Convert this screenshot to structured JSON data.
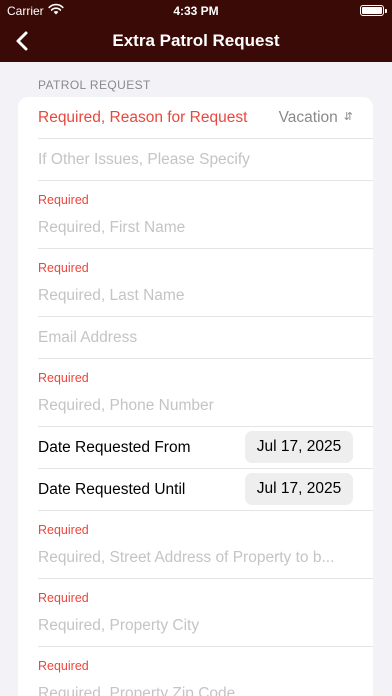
{
  "status_bar": {
    "carrier": "Carrier",
    "time": "4:33 PM"
  },
  "nav": {
    "title": "Extra Patrol Request"
  },
  "section": {
    "header": "PATROL REQUEST"
  },
  "form": {
    "reason": {
      "label": "Required, Reason for Request",
      "value": "Vacation"
    },
    "other_issues": {
      "placeholder": "If Other Issues, Please Specify"
    },
    "first_name": {
      "required": "Required",
      "placeholder": "Required, First Name"
    },
    "last_name": {
      "required": "Required",
      "placeholder": "Required, Last Name"
    },
    "email": {
      "placeholder": "Email Address"
    },
    "phone": {
      "required": "Required",
      "placeholder": "Required, Phone Number"
    },
    "date_from": {
      "label": "Date Requested From",
      "value": "Jul 17, 2025"
    },
    "date_until": {
      "label": "Date Requested Until",
      "value": "Jul 17, 2025"
    },
    "street": {
      "required": "Required",
      "placeholder": "Required, Street Address of Property to b..."
    },
    "city": {
      "required": "Required",
      "placeholder": "Required, Property City"
    },
    "zip": {
      "required": "Required",
      "placeholder": "Required, Property Zip Code"
    }
  }
}
